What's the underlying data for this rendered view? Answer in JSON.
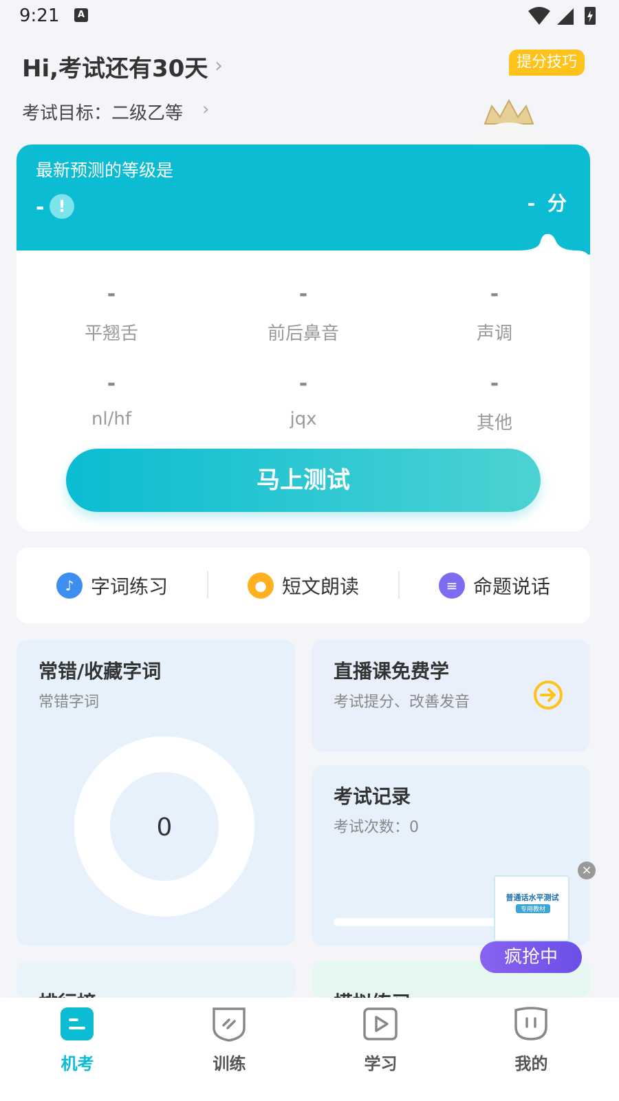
{
  "status_bar": {
    "time": "9:21",
    "notification_icon": "A"
  },
  "header": {
    "greeting": "Hi,考试还有30天",
    "goal": "考试目标：二级乙等",
    "tip_badge": "提分技巧"
  },
  "prediction": {
    "label": "最新预测的等级是",
    "level": "-",
    "score_value": "-",
    "score_unit": "分",
    "metrics": [
      {
        "value": "-",
        "label": "平翘舌"
      },
      {
        "value": "-",
        "label": "前后鼻音"
      },
      {
        "value": "-",
        "label": "声调"
      },
      {
        "value": "-",
        "label": "nl/hf"
      },
      {
        "value": "-",
        "label": "jqx"
      },
      {
        "value": "-",
        "label": "其他"
      }
    ],
    "test_button": "马上测试"
  },
  "shortcuts": [
    {
      "label": "字词练习",
      "icon": "mic-icon",
      "color": "#3d8ef0"
    },
    {
      "label": "短文朗读",
      "icon": "reading-icon",
      "color": "#ffb020"
    },
    {
      "label": "命题说话",
      "icon": "chat-icon",
      "color": "#7d6cf0"
    }
  ],
  "tiles": {
    "mistakes": {
      "title": "常错/收藏字词",
      "subtitle": "常错字词",
      "count": "0"
    },
    "live": {
      "title": "直播课免费学",
      "subtitle": "考试提分、改善发音"
    },
    "records": {
      "title": "考试记录",
      "subtitle": "考试次数：0"
    },
    "ranking": {
      "title": "排行榜"
    },
    "mock": {
      "title": "模拟练习"
    }
  },
  "promo": {
    "book_title": "普通话水平测试",
    "book_subtitle": "专用教材",
    "button": "疯抢中"
  },
  "tabbar": [
    {
      "label": "机考",
      "active": true
    },
    {
      "label": "训练",
      "active": false
    },
    {
      "label": "学习",
      "active": false
    },
    {
      "label": "我的",
      "active": false
    }
  ],
  "colors": {
    "accent": "#0bbcd2",
    "badge": "#ffc21a",
    "promo": "#7b59ec"
  }
}
